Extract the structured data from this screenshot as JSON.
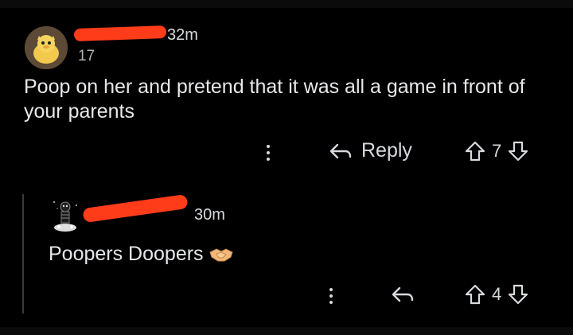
{
  "comment": {
    "timestamp": "32m",
    "flair": "17",
    "body": "Poop on her and pretend that it was all a game in front of your parents",
    "actions": {
      "reply_label": "Reply",
      "score": "7"
    }
  },
  "reply": {
    "timestamp": "30m",
    "body": "Poopers Doopers",
    "actions": {
      "score": "4"
    }
  },
  "colors": {
    "background": "#000000",
    "text": "#d7dadc",
    "redaction": "#ff3c1a"
  },
  "icons": [
    "reply-arrow-icon",
    "upvote-icon",
    "downvote-icon",
    "more-options-icon",
    "handshake-emoji"
  ]
}
